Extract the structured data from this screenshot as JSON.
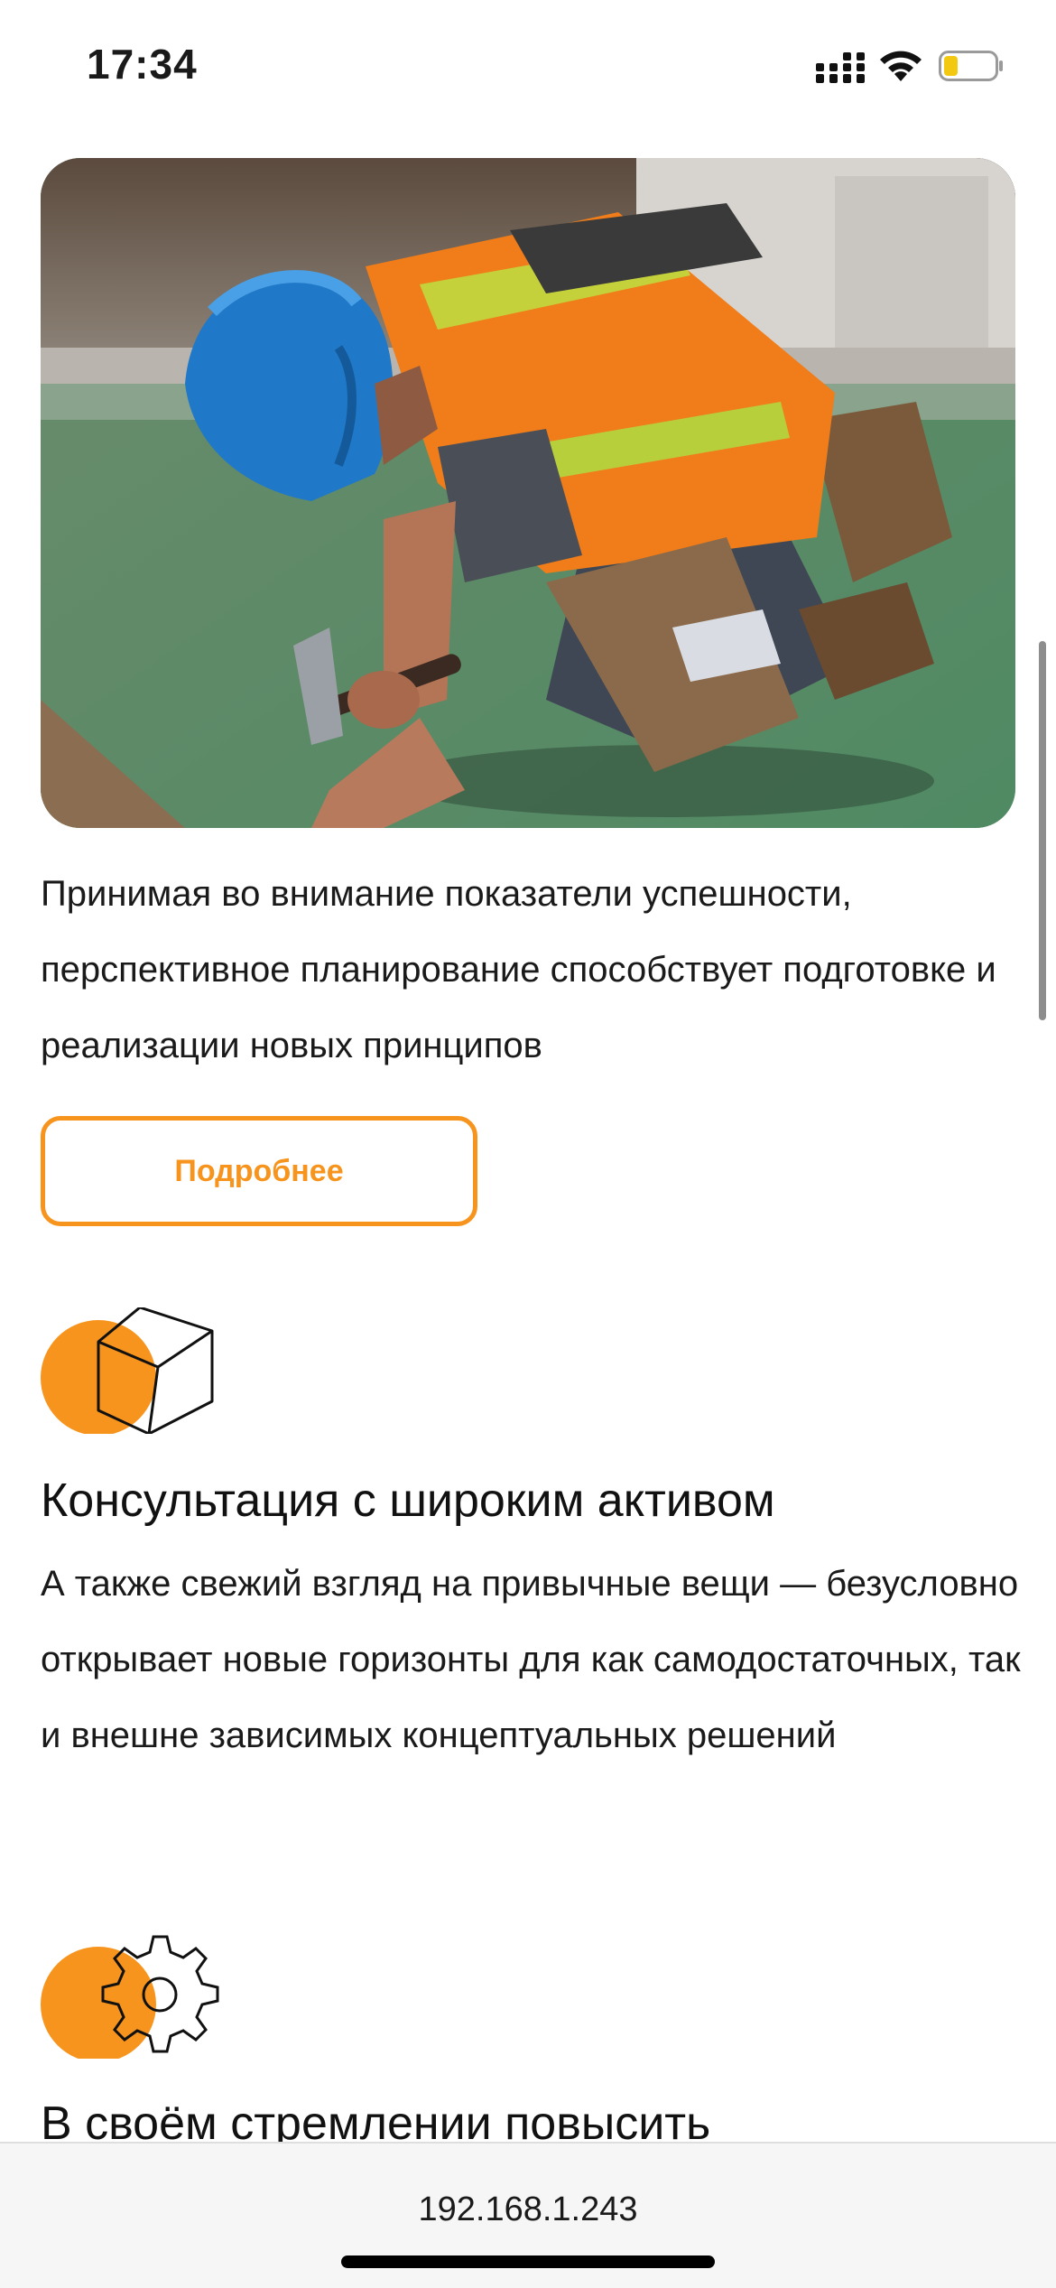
{
  "status_bar": {
    "time": "17:34",
    "icons": [
      "cellular-signal-icon",
      "wifi-icon",
      "battery-low-icon"
    ]
  },
  "hero_image": {
    "description_icon": "construction-worker-photo"
  },
  "intro": {
    "text": "Принимая во внимание показатели успешности, перспективное планирование способствует подготовке и реализации новых принципов",
    "button_label": "Подробнее"
  },
  "features": [
    {
      "icon": "cube-icon",
      "title": "Консультация с широким активом",
      "text": "А также свежий взгляд на привычные вещи — безусловно открывает новые горизонты для как самодостаточных, так и внешне зависимых концептуальных решений"
    },
    {
      "icon": "gear-icon",
      "title": "В своём стремлении повысить"
    }
  ],
  "browser": {
    "url": "192.168.1.243"
  },
  "colors": {
    "accent": "#f7941d",
    "text": "#1a1a1a",
    "background": "#ffffff"
  }
}
